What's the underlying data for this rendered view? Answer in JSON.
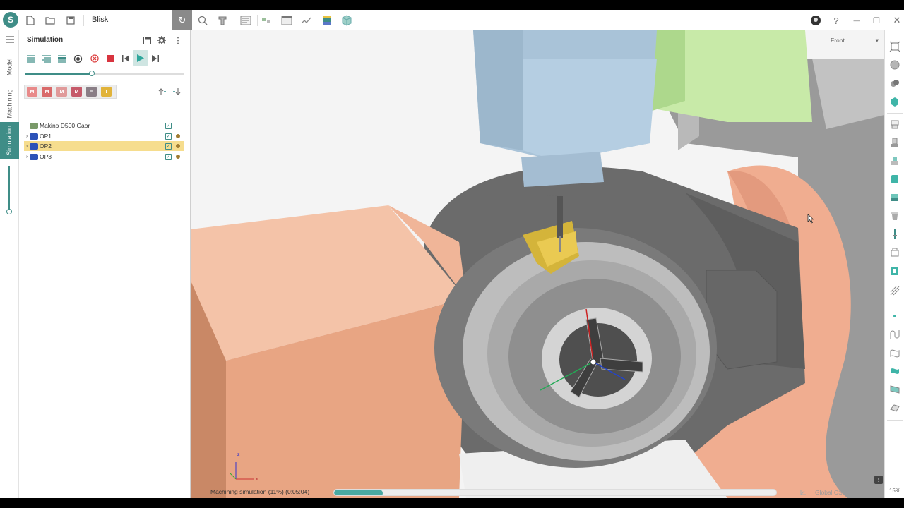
{
  "window": {
    "title": "Blisk",
    "help_glyph": "?",
    "minimize_glyph": "—",
    "restore_glyph": "❐",
    "close_glyph": "✕"
  },
  "side_tabs": [
    {
      "label": "Model"
    },
    {
      "label": "Machining"
    },
    {
      "label": "Simulation",
      "active": true
    }
  ],
  "panel": {
    "title": "Simulation",
    "progress_fraction": 0.42,
    "filter_icons": [
      "M",
      "M",
      "M",
      "M",
      "≡",
      "!"
    ]
  },
  "tree": [
    {
      "label": "Makino D500 Gaor",
      "type": "machine",
      "selected": false
    },
    {
      "label": "OP1",
      "type": "operation",
      "selected": false
    },
    {
      "label": "OP2",
      "type": "operation",
      "selected": true
    },
    {
      "label": "OP3",
      "type": "operation",
      "selected": false
    }
  ],
  "viewport": {
    "view_name": "Front",
    "status_text": "Machining simulation (11%) (0:05:04)",
    "status_progress": 0.11,
    "coord_system": "Global CS",
    "zoom": "15%"
  },
  "colors": {
    "accent": "#3f8d87",
    "selection": "#f6dd8e",
    "machine_body": "#f2b79a",
    "spindle": "#a9c3d8",
    "green_part": "#c8eaa8",
    "fixture": "#6f6f6f"
  }
}
